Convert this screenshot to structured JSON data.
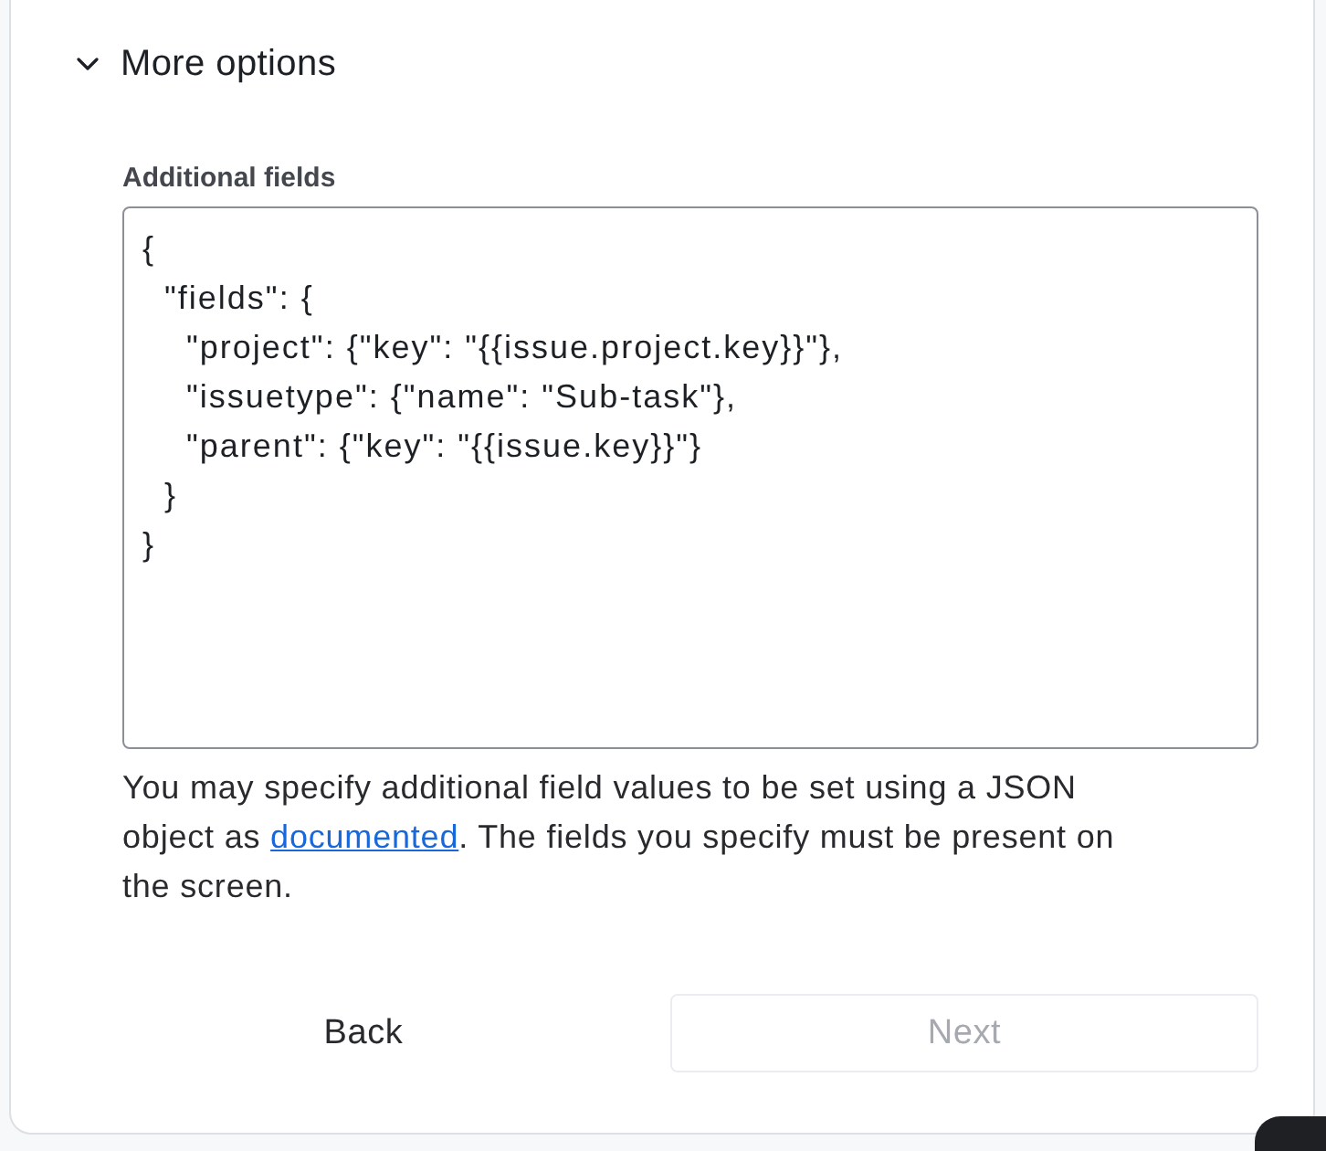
{
  "section": {
    "title": "More options",
    "expanded": true
  },
  "additional_fields": {
    "label": "Additional fields",
    "value": "{\n  \"fields\": {\n    \"project\": {\"key\": \"{{issue.project.key}}\"},\n    \"issuetype\": {\"name\": \"Sub-task\"},\n    \"parent\": {\"key\": \"{{issue.key}}\"}\n  }\n}"
  },
  "help_text": {
    "before": "You may specify additional field values to be set using a JSON object as ",
    "link": "documented",
    "after": ". The fields you specify must be present on the screen."
  },
  "buttons": [
    {
      "label": "Back",
      "disabled": false
    },
    {
      "label": "Next",
      "disabled": true
    }
  ]
}
